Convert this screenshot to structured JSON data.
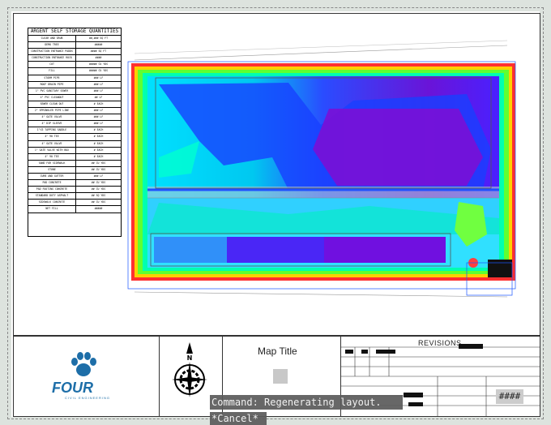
{
  "quantities_table": {
    "title": "ARGENT SELF STORAGE QUANTITIES",
    "rows": [
      [
        "CLEAR AND GRUB",
        "##,### SQ FT"
      ],
      [
        "DEMO TREE",
        "#####"
      ],
      [
        "CONSTRUCTION ENTRANCE PADDS",
        "#### SQ FT"
      ],
      [
        "CONSTRUCTION ENTRANCE ROCK",
        "####"
      ],
      [
        "CUT",
        "##### CU YDS"
      ],
      [
        "FILL",
        "##### CU YDS"
      ],
      [
        "STORM PIPE",
        "### LF"
      ],
      [
        "ROOF DRAIN PIPE",
        "### LF"
      ],
      [
        "1\" PVC SANITARY SEWER",
        "### LF"
      ],
      [
        "4\" PVC CLEANOUT",
        "## LF"
      ],
      [
        "SEWER CLEAN OUT",
        "# EACH"
      ],
      [
        "2\" SPRINKLER PIPE LINE",
        "### LF"
      ],
      [
        "4\" GATE VALVE",
        "### LF"
      ],
      [
        "4\" DIP SLEEVE",
        "### LF"
      ],
      [
        "1\"X3 TAPPING SADDLE",
        "# EACH"
      ],
      [
        "4\" 90 TEE",
        "# EACH"
      ],
      [
        "4\" GATE VALVE",
        "# EACH"
      ],
      [
        "1\" GATE VALVE WITH BOX",
        "# EACH"
      ],
      [
        "4\" 90 TEE",
        "# EACH"
      ],
      [
        "SAND FOR SIDEWALK",
        "## CU YDS"
      ],
      [
        "STONE",
        "## CU YDS"
      ],
      [
        "CURB AND GUTTER",
        "### LF"
      ],
      [
        "PAD CONCRETE",
        "## CU YDS"
      ],
      [
        "PAD FOOTING CONCRETE",
        "## CU YDS"
      ],
      [
        "STANDARD DUTY ASPHALT",
        "## SQ YDS"
      ],
      [
        "SIDEWALK CONCRETE",
        "## CU YDS"
      ],
      [
        "NET FILL",
        "#####"
      ]
    ]
  },
  "title_block": {
    "logo_text": "FOUR",
    "logo_subtext": "CIVIL ENGINEERING",
    "map_title": "Map Title",
    "revisions_label": "REVISIONS",
    "sheet_number": "####"
  },
  "command_line": {
    "message": "Command: Regenerating layout.",
    "cancel": "*Cancel*"
  },
  "icons": {
    "compass": "north-arrow-icon",
    "paw": "paw-icon"
  },
  "colors": {
    "background": "#dde3de",
    "logo": "#1d6ea8",
    "command_bg": "#5a5a5a"
  }
}
